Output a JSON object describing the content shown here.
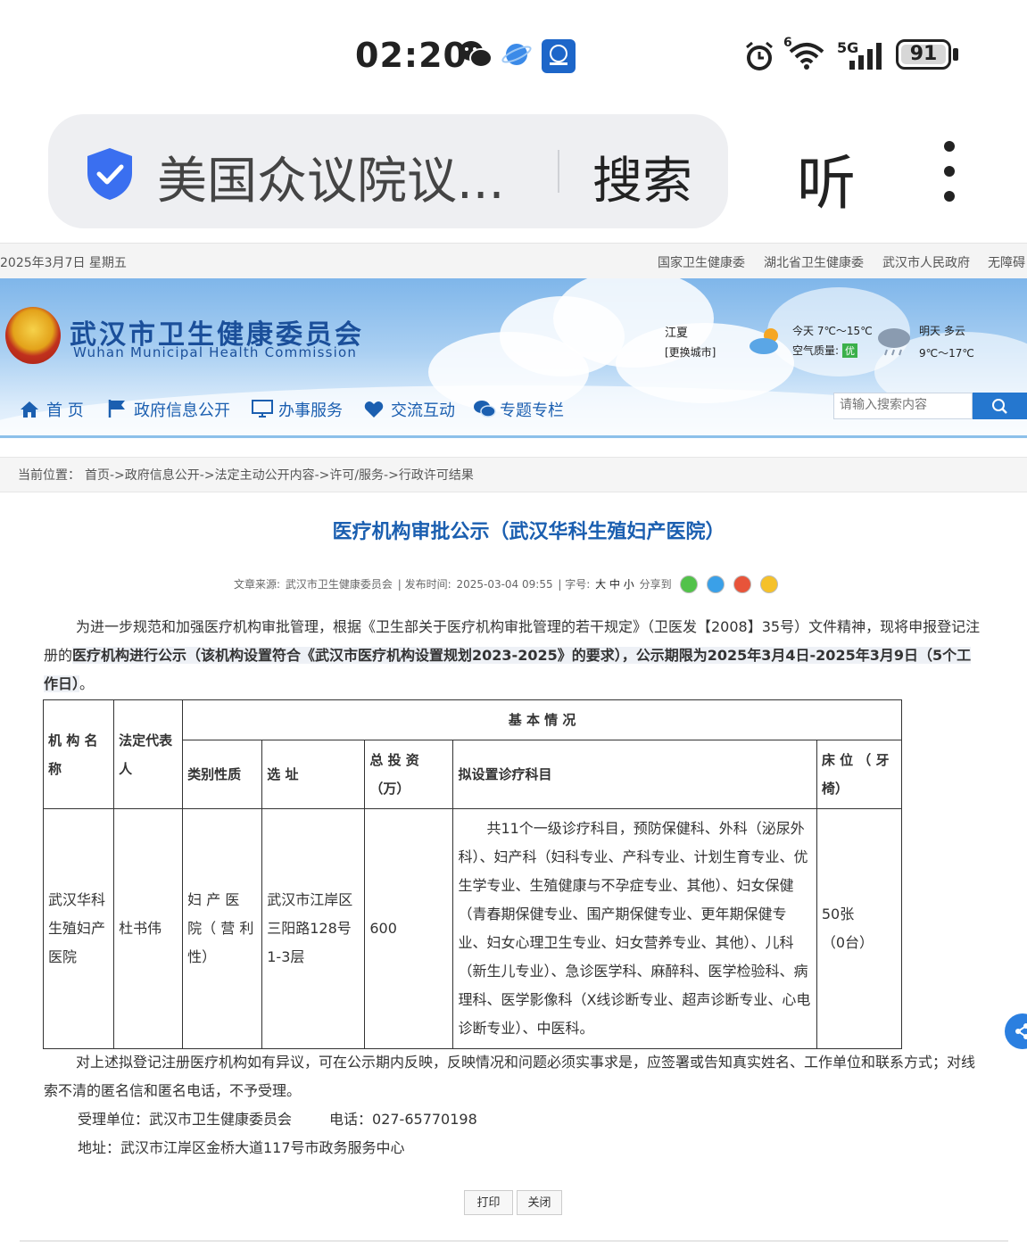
{
  "status_bar": {
    "time": "02:20",
    "battery": "91",
    "network": "5G",
    "wifi_badge": "6"
  },
  "browser": {
    "query": "美国众议院议...",
    "search_label": "搜索",
    "listen_label": "听"
  },
  "site_top": {
    "date": "2025年3月7日 星期五",
    "links": [
      "国家卫生健康委",
      "湖北省卫生健康委",
      "武汉市人民政府",
      "无障碍"
    ]
  },
  "banner": {
    "org_cn": "武汉市卫生健康委员会",
    "org_en": "Wuhan Municipal Health Commission",
    "weather": {
      "city": "江夏",
      "change_city": "[更换城市]",
      "today": "今天  7℃～15℃",
      "air_label": "空气质量:",
      "air_value": "优",
      "tomorrow": "明天  多云",
      "tomorrow_temp": "9℃～17℃"
    }
  },
  "nav": {
    "items": [
      "首  页",
      "政府信息公开",
      "办事服务",
      "交流互动",
      "专题专栏"
    ],
    "search_placeholder": "请输入搜索内容"
  },
  "breadcrumb": {
    "label": "当前位置：",
    "path": "首页->政府信息公开->法定主动公开内容->许可/服务->行政许可结果"
  },
  "article": {
    "title": "医疗机构审批公示（武汉华科生殖妇产医院）",
    "meta": {
      "source_label": "文章来源:",
      "source": "武汉市卫生健康委员会",
      "publish_label": "| 发布时间:",
      "publish_time": "2025-03-04 09:55",
      "fontsize_label": "| 字号:",
      "sizes": "大 中 小",
      "share_label": "分享到"
    },
    "intro_part1": "为进一步规范和加强医疗机构审批管理，根据《卫生部关于医疗机构审批管理的若干规定》（卫医发【2008】35号）文件精神，现将申报登记注册的",
    "intro_bold1": "医疗机构进行公示（该机构设置符合《武汉市医疗机构设置规划2023-2025》的要求），",
    "intro_bold2": "公示期限为2025年3月4日-2025年3月9日（5个工作日）",
    "intro_end": "。",
    "table": {
      "headers": {
        "org_name": "机  构  名  称",
        "legal_rep": "法定代表人",
        "basic_info": "基 本 情 况",
        "category": "类别性质",
        "address": "选  址",
        "investment": "总  投  资（万）",
        "departments": "拟设置诊疗科目",
        "beds": "床 位 （ 牙 椅）"
      },
      "row": {
        "org_name": "武汉华科生殖妇产医院",
        "legal_rep": "杜书伟",
        "category": "妇 产 医 院（  营  利性）",
        "address": "武汉市江岸区三阳路128号1-3层",
        "investment": "600",
        "departments": "共11个一级诊疗科目，预防保健科、外科（泌尿外科）、妇产科（妇科专业、产科专业、计划生育专业、优生学专业、生殖健康与不孕症专业、其他）、妇女保健（青春期保健专业、围产期保健专业、更年期保健专业、妇女心理卫生专业、妇女营养专业、其他）、儿科（新生儿专业）、急诊医学科、麻醉科、医学检验科、病理科、医学影像科（X线诊断专业、超声诊断专业、心电诊断专业）、中医科。",
        "beds": "50张",
        "chairs": "（0台）"
      }
    },
    "objection": "对上述拟登记注册医疗机构如有异议，可在公示期内反映，反映情况和问题必须实事求是，应签署或告知真实姓名、工作单位和联系方式；对线索不清的匿名信和匿名电话，不予受理。",
    "contact_unit": "受理单位：武汉市卫生健康委员会",
    "contact_phone": "电话：027-65770198",
    "address_line": "地址：武汉市江岸区金桥大道117号市政务服务中心",
    "print_label": "打印",
    "close_label": "关闭"
  },
  "colors": {
    "link_blue": "#1b5fb0",
    "search_blue": "#2577cf",
    "shield_blue": "#3a6ff0"
  }
}
